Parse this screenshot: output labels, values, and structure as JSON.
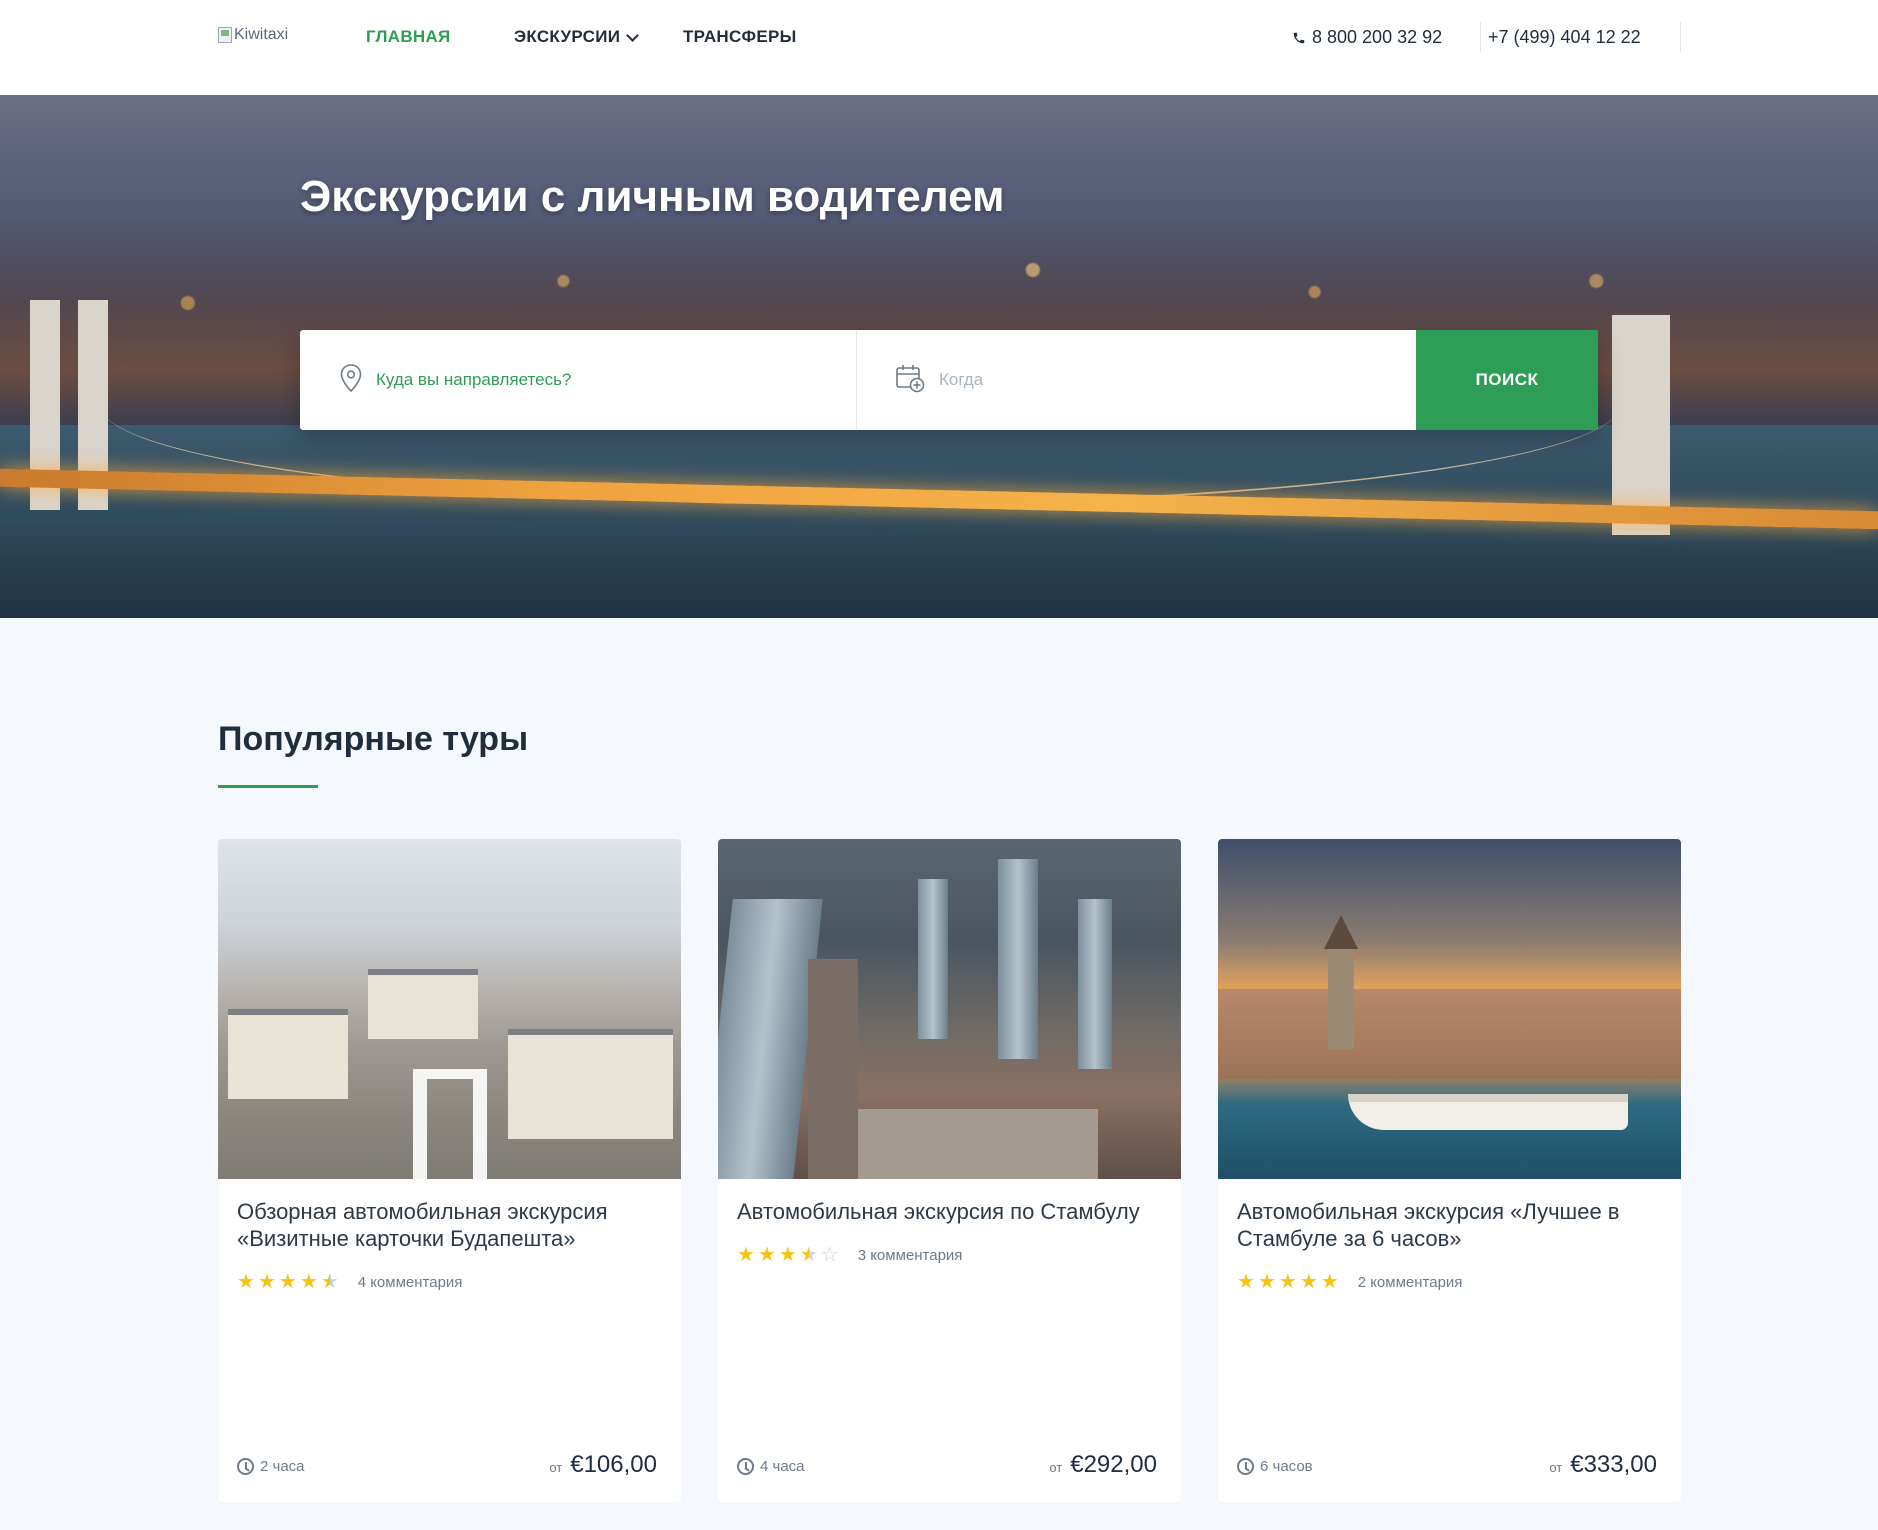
{
  "header": {
    "logo_alt": "Kiwitaxi",
    "nav": [
      {
        "label": "ГЛАВНАЯ",
        "active": true
      },
      {
        "label": "ЭКСКУРСИИ",
        "has_dropdown": true
      },
      {
        "label": "ТРАНСФЕРЫ"
      }
    ],
    "phones": [
      "8 800 200 32 92",
      "+7 (499) 404 12 22"
    ]
  },
  "hero": {
    "title": "Экскурсии с личным водителем",
    "search": {
      "destination_placeholder": "Куда вы направляетесь?",
      "date_placeholder": "Когда",
      "button_label": "ПОИСК"
    }
  },
  "popular": {
    "title": "Популярные туры",
    "tours": [
      {
        "title": "Обзорная автомобильная экскурсия «Визитные карточки Будапешта»",
        "rating": 4.5,
        "comments": "4 комментария",
        "duration": "2 часа",
        "price_prefix": "от",
        "price": "€106,00"
      },
      {
        "title": "Автомобильная экскурсия по Стамбулу",
        "rating": 3.5,
        "comments": "3 комментария",
        "duration": "4 часа",
        "price_prefix": "от",
        "price": "€292,00"
      },
      {
        "title": "Автомобильная экскурсия «Лучшее в Стамбуле за 6 часов»",
        "rating": 5,
        "comments": "2 комментария",
        "duration": "6 часов",
        "price_prefix": "от",
        "price": "€333,00"
      }
    ]
  },
  "colors": {
    "accent": "#2e9e56",
    "text": "#1f2d3d",
    "star": "#f4c415",
    "background": "#f5f8fc"
  }
}
